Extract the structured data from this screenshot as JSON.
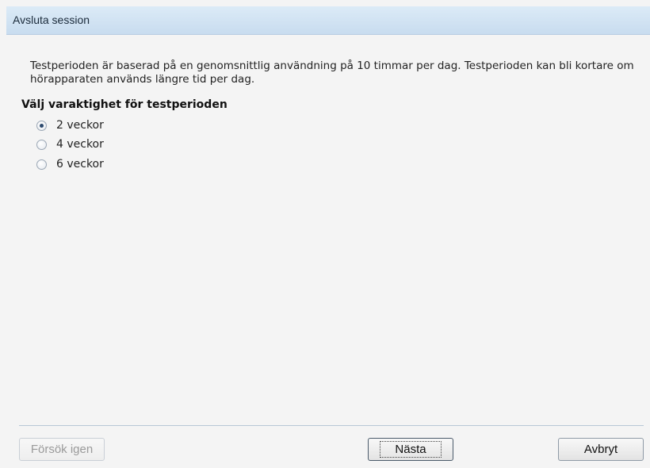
{
  "window": {
    "title": "Avsluta session"
  },
  "main": {
    "description": "Testperioden är baserad på en genomsnittlig användning på 10 timmar per dag. Testperioden kan bli kortare om hörapparaten används längre tid per dag.",
    "heading": "Välj varaktighet för testperioden",
    "options": [
      {
        "label": "2 veckor",
        "selected": true
      },
      {
        "label": "4 veckor",
        "selected": false
      },
      {
        "label": "6 veckor",
        "selected": false
      }
    ]
  },
  "footer": {
    "retry_label": "Försök igen",
    "next_label": "Nästa",
    "cancel_label": "Avbryt"
  }
}
